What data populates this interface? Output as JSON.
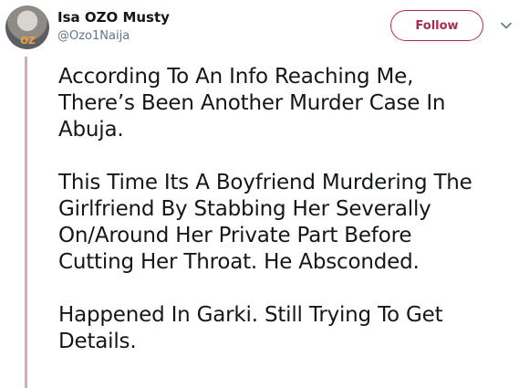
{
  "tweet": {
    "display_name": "Isa OZO Musty",
    "handle": "@Ozo1Naija",
    "avatar_badge_text": "OZ",
    "follow_label": "Follow",
    "paragraphs": [
      "According To An Info Reaching Me,\nThere’s Been Another Murder Case In\nAbuja.",
      "This Time Its A Boyfriend Murdering The\nGirlfriend By Stabbing Her Severally\nOn/Around Her Private Part Before\nCutting Her Throat. He Absconded.",
      "Happened In Garki. Still Trying To Get\nDetails."
    ]
  },
  "colors": {
    "accent": "#ad2c4c",
    "thread_line": "#d7a9bd",
    "text_primary": "#14171a",
    "text_secondary": "#657786"
  },
  "icons": {
    "caret": "chevron-down-icon"
  }
}
